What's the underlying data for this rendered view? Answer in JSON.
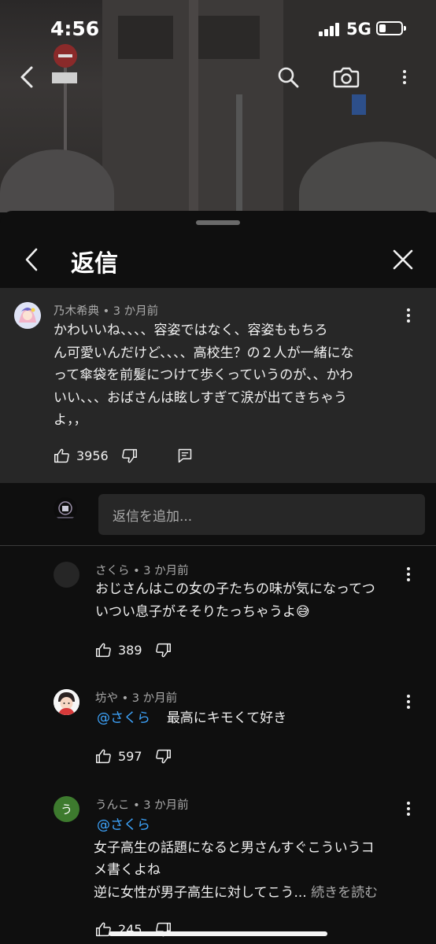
{
  "status_bar": {
    "time": "4:56",
    "network": "5G"
  },
  "sheet": {
    "title": "返信"
  },
  "parent_comment": {
    "author": "乃木希典",
    "age": "3 か月前",
    "text_lines": [
      "かわいいね、、、、容姿ではなく、容姿ももちろ",
      "ん可愛いんだけど、、、、高校生？の２人が一緒にな",
      "って傘袋を前髪につけて歩くっていうのが、、かわ",
      "いい、、、おばさんは眩しすぎて涙が出てきちゃう",
      "よ，，"
    ],
    "likes": "3956"
  },
  "reply_input": {
    "placeholder": "返信を追加..."
  },
  "replies": [
    {
      "author": "さくら",
      "age": "3 か月前",
      "text_lines": [
        "おじさんはこの女の子たちの味が気になってつ",
        "いつい息子がそそりたっちゃうよ"
      ],
      "emoji": "😅",
      "likes": "389"
    },
    {
      "author": "坊や",
      "age": "3 か月前",
      "mention": "@さくら",
      "text": "最高にキモくて好き",
      "likes": "597"
    },
    {
      "author": "うんこ",
      "avatar_letter": "う",
      "age": "3 か月前",
      "mention": "@さくら",
      "text_lines": [
        "女子高生の話題になると男さんすぐこういうコ",
        "メ書くよね",
        "逆に女性が男子高生に対してこう..."
      ],
      "read_more": "続きを読む",
      "likes": "245"
    }
  ],
  "icons": {
    "back": "chevron-left-icon",
    "search": "search-icon",
    "camera": "camera-icon",
    "more": "more-vert-icon",
    "close": "close-icon",
    "like": "thumbs-up-icon",
    "dislike": "thumbs-down-icon",
    "reply": "reply-icon"
  },
  "colors": {
    "sheet_bg": "#0f0f0f",
    "highlight_bg": "#272727",
    "mention": "#3ea6ff",
    "avatar_unko": "#3d7a2e"
  }
}
